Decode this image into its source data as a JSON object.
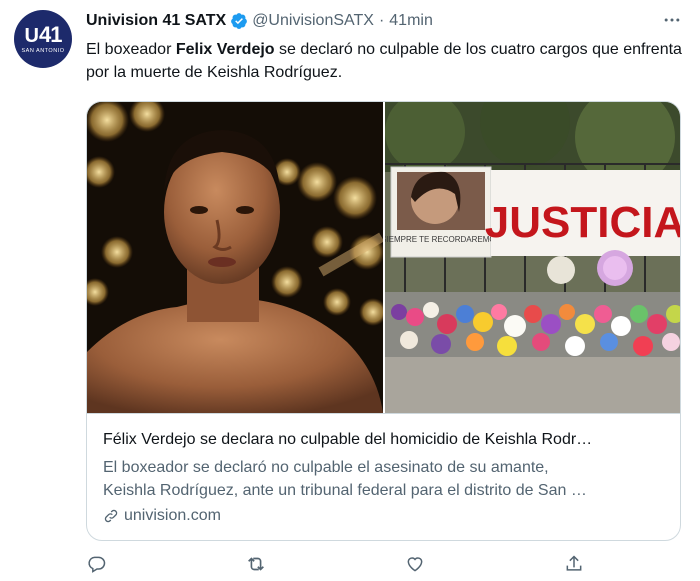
{
  "account": {
    "name": "Univision 41 SATX",
    "handle": "@UnivisionSATX",
    "separator": "·",
    "time": "41min",
    "avatar_number": "41",
    "avatar_subtitle": "SAN ANTONIO"
  },
  "tweet": {
    "text_before": "El boxeador ",
    "text_bold": "Felix Verdejo",
    "text_after": " se declaró no culpable de los cuatro cargos que enfrenta por la muerte de Keishla Rodríguez."
  },
  "card": {
    "title": "Félix Verdejo se declara no culpable del homicidio de Keishla Rodr…",
    "description_line1": "El boxeador se declaró no culpable el asesinato de su amante,",
    "description_line2": "Keishla Rodríguez, ante un tribunal federal para el distrito de San …",
    "domain": "univision.com",
    "banner_text": "JUSTICIA",
    "poster_text": "SIEMPRE TE RECORDAREMOS"
  },
  "icons": {
    "verified": "verified-badge-icon",
    "more": "more-options-icon",
    "reply": "reply-icon",
    "retweet": "retweet-icon",
    "like": "like-icon",
    "share": "share-icon",
    "link": "link-icon"
  },
  "colors": {
    "brand_blue": "#1d9bf0",
    "text": "#0f1419",
    "secondary": "#536471",
    "border": "#cfd9de",
    "avatar_bg": "#1d2a6b"
  }
}
